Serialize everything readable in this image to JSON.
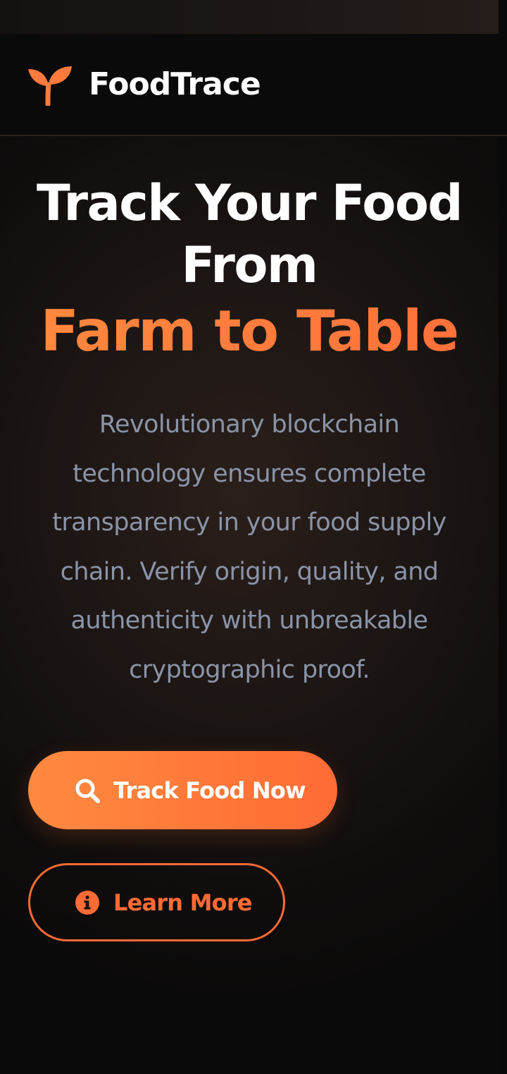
{
  "header": {
    "brand": "FoodTrace",
    "logo_icon": "sprout-icon",
    "colors": {
      "background": "#0a0a0a",
      "brand_text": "#ffffff",
      "logo": "#ff7a3d"
    }
  },
  "hero": {
    "title_line_1": "Track Your Food",
    "title_line_2": "From",
    "title_accent": "Farm to Table",
    "description": "Revolutionary blockchain technology ensures complete transparency in your food supply chain. Verify origin, quality, and authenticity with unbreakable cryptographic proof.",
    "colors": {
      "title": "#ffffff",
      "accent": "#ff7a3d",
      "description": "#8a94a8"
    }
  },
  "actions": {
    "primary": {
      "label": "Track Food Now",
      "icon": "search-icon",
      "color": "#ff6b35"
    },
    "secondary": {
      "label": "Learn More",
      "icon": "info-circle-icon",
      "color": "#ff6b35"
    }
  }
}
